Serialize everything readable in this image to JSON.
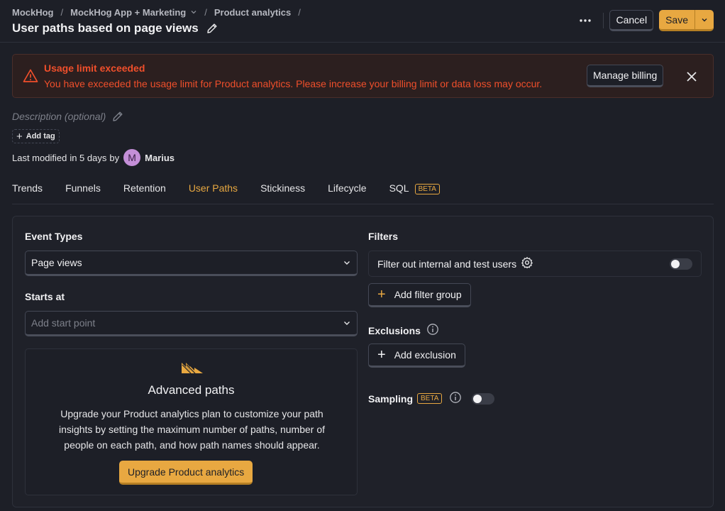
{
  "header": {
    "breadcrumbs": [
      "MockHog",
      "MockHog App + Marketing",
      "Product analytics"
    ],
    "title": "User paths based on page views",
    "cancel_label": "Cancel",
    "save_label": "Save"
  },
  "alert": {
    "title": "Usage limit exceeded",
    "message": "You have exceeded the usage limit for Product analytics. Please increase your billing limit or data loss may occur.",
    "button_label": "Manage billing",
    "color": "#f04f2b"
  },
  "meta": {
    "description_placeholder": "Description (optional)",
    "add_tag_label": "Add tag",
    "modified_prefix": "Last modified",
    "modified_time": "in 5 days",
    "modified_by": "by",
    "user_initial": "M",
    "user_name": "Marius"
  },
  "tabs": [
    {
      "label": "Trends"
    },
    {
      "label": "Funnels"
    },
    {
      "label": "Retention"
    },
    {
      "label": "User Paths",
      "active": true
    },
    {
      "label": "Stickiness"
    },
    {
      "label": "Lifecycle"
    },
    {
      "label": "SQL",
      "badge": "BETA"
    }
  ],
  "left": {
    "event_types_label": "Event Types",
    "event_types_value": "Page views",
    "starts_at_label": "Starts at",
    "starts_at_placeholder": "Add start point",
    "upgrade": {
      "title": "Advanced paths",
      "body": "Upgrade your Product analytics plan to customize your path insights by setting the maximum number of paths, number of people on each path, and how path names should appear.",
      "button_label": "Upgrade Product analytics"
    }
  },
  "right": {
    "filters_label": "Filters",
    "filter_internal_label": "Filter out internal and test users",
    "filter_internal_on": false,
    "add_filter_group_label": "Add filter group",
    "exclusions_label": "Exclusions",
    "add_exclusion_label": "Add exclusion",
    "sampling_label": "Sampling",
    "sampling_badge": "BETA",
    "sampling_on": false
  },
  "colors": {
    "accent": "#e8a841",
    "background": "#1d1f27",
    "danger": "#f04f2b"
  }
}
